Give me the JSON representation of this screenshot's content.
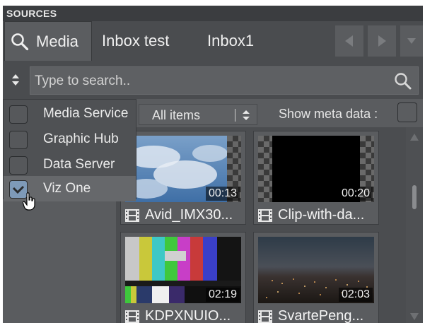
{
  "panel": {
    "title": "SOURCES"
  },
  "tabs": [
    {
      "label": "Media",
      "active": true
    },
    {
      "label": "Inbox test",
      "active": false
    },
    {
      "label": "Inbox1",
      "active": false
    }
  ],
  "search": {
    "placeholder": "Type to search.."
  },
  "toolbar": {
    "filter_value": "All items",
    "meta_label": "Show meta data :",
    "meta_checked": false
  },
  "sources_menu": [
    {
      "label": "Media Service",
      "checked": false
    },
    {
      "label": "Graphic Hub",
      "checked": false
    },
    {
      "label": "Data Server",
      "checked": false
    },
    {
      "label": "Viz One",
      "checked": true
    }
  ],
  "items": [
    {
      "title": "Avid_IMX30...",
      "duration": "00:13"
    },
    {
      "title": "Clip-with-da...",
      "duration": "00:20"
    },
    {
      "title": "KDPXNUIO...",
      "duration": "02:19"
    },
    {
      "title": "SvartePeng...",
      "duration": "02:03"
    }
  ],
  "colors": {
    "accent_check": "#7e9ab8",
    "panel_bg": "#55575a",
    "header_bg": "#3b3d40"
  }
}
